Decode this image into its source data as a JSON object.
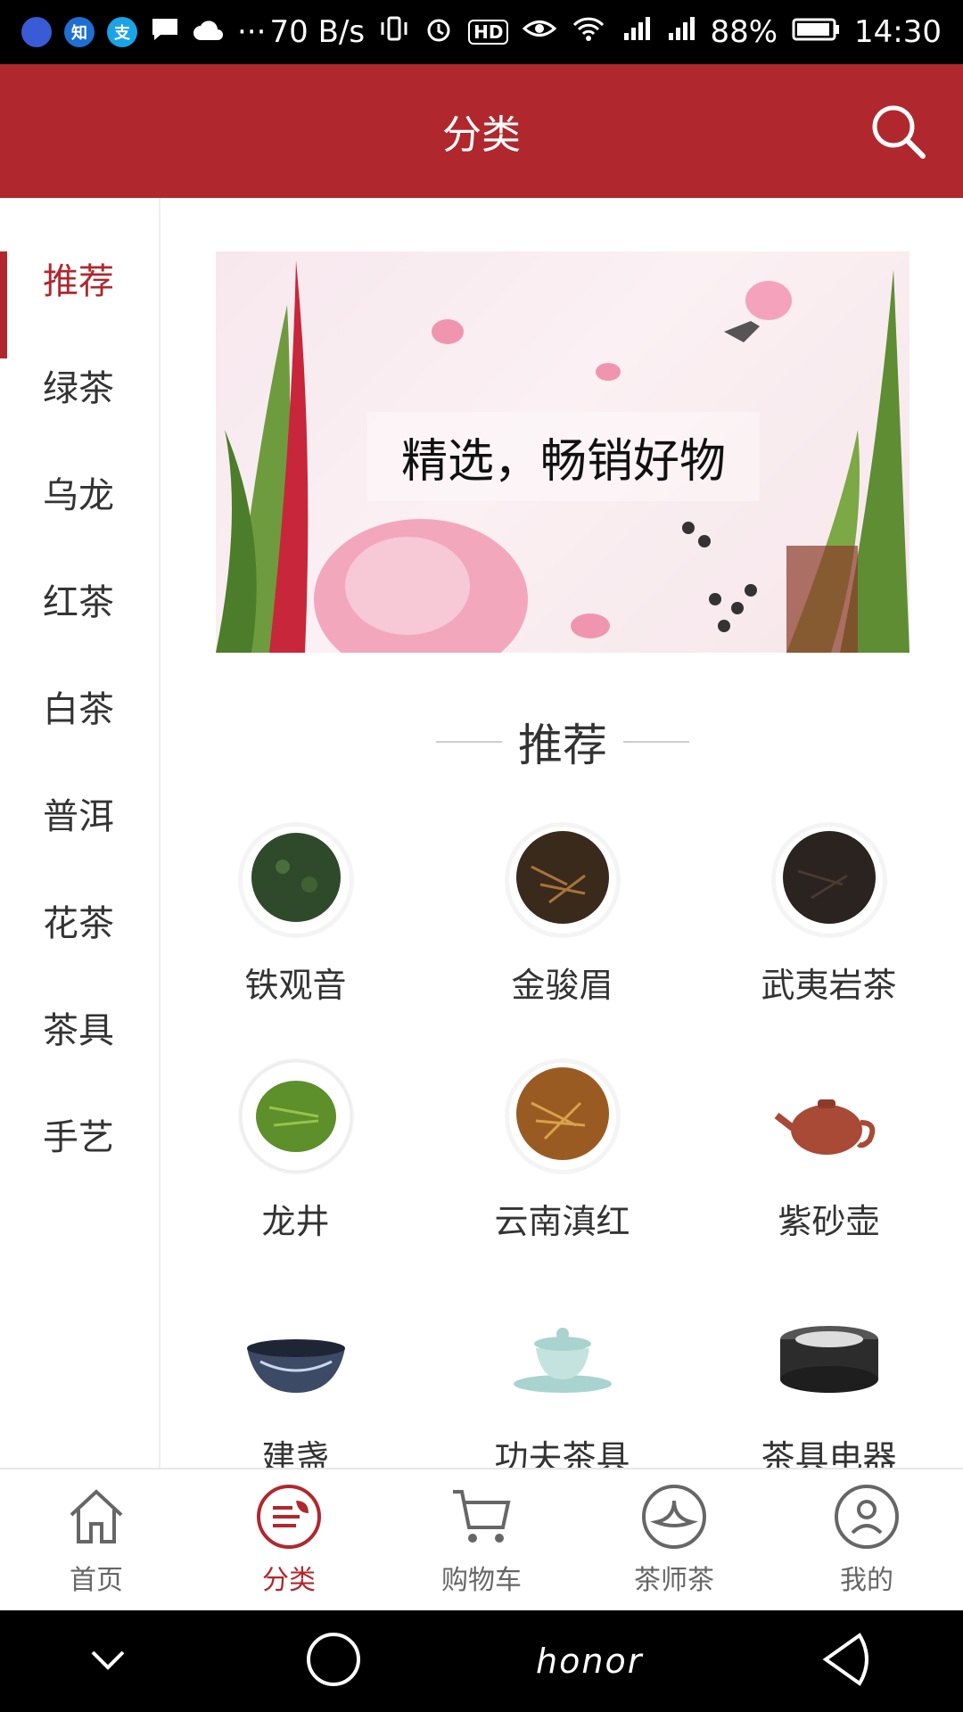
{
  "status_bar": {
    "speed": "70 B/s",
    "battery": "88%",
    "time": "14:30",
    "left_icons": [
      "app-icon-1",
      "zhihu-icon",
      "alipay-icon",
      "chat-icon",
      "cloud-icon",
      "more-icon"
    ],
    "left_icon_labels": [
      "知",
      "支"
    ],
    "hd_badge": "HD",
    "more": "···"
  },
  "header": {
    "title": "分类",
    "search_icon": "search-icon"
  },
  "sidebar": {
    "items": [
      {
        "label": "推荐",
        "active": true
      },
      {
        "label": "绿茶",
        "active": false
      },
      {
        "label": "乌龙",
        "active": false
      },
      {
        "label": "红茶",
        "active": false
      },
      {
        "label": "白茶",
        "active": false
      },
      {
        "label": "普洱",
        "active": false
      },
      {
        "label": "花茶",
        "active": false
      },
      {
        "label": "茶具",
        "active": false
      },
      {
        "label": "手艺",
        "active": false
      }
    ]
  },
  "banner": {
    "caption": "精选，畅销好物"
  },
  "section": {
    "title": "推荐",
    "items": [
      {
        "label": "铁观音",
        "color": "#2e4a2a"
      },
      {
        "label": "金骏眉",
        "color": "#3a2a1c"
      },
      {
        "label": "武夷岩茶",
        "color": "#2a2320"
      },
      {
        "label": "龙井",
        "color": "#5d8f2b"
      },
      {
        "label": "云南滇红",
        "color": "#9a5b22"
      },
      {
        "label": "紫砂壶",
        "color": "#a84a36"
      },
      {
        "label": "建盏",
        "color": "#3d4a66"
      },
      {
        "label": "功夫茶具",
        "color": "#a9d3cf"
      },
      {
        "label": "茶具电器",
        "color": "#2c2c2c"
      }
    ]
  },
  "tabbar": {
    "tabs": [
      {
        "label": "首页",
        "icon": "home-icon",
        "active": false
      },
      {
        "label": "分类",
        "icon": "category-icon",
        "active": true
      },
      {
        "label": "购物车",
        "icon": "cart-icon",
        "active": false
      },
      {
        "label": "茶师茶",
        "icon": "tea-leaf-icon",
        "active": false
      },
      {
        "label": "我的",
        "icon": "profile-icon",
        "active": false
      }
    ]
  },
  "navbar": {
    "brand": "honor"
  },
  "colors": {
    "accent": "#b0282e"
  }
}
